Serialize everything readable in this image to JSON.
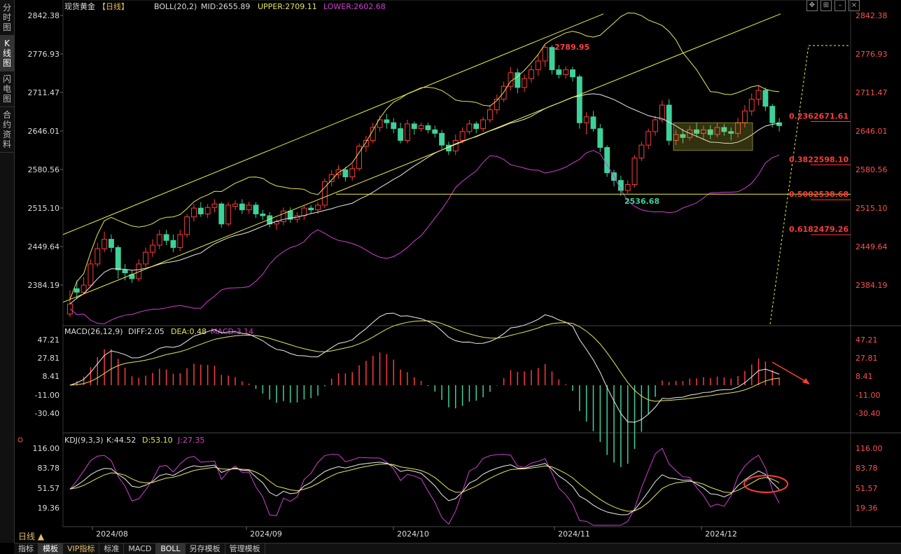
{
  "sidebar": [
    {
      "label": "分\n时\n图",
      "active": false
    },
    {
      "label": "K\n线\n图",
      "active": true
    },
    {
      "label": "闪\n电\n图",
      "active": false
    },
    {
      "label": "合\n约\n资\n料",
      "active": false
    }
  ],
  "header": {
    "title": "现货黄金",
    "period": "【日线】",
    "boll": "BOLL(20,2)",
    "mid": "MID:2655.89",
    "upper": "UPPER:2709.11",
    "lower": "LOWER:2602.68"
  },
  "macd_header": {
    "name": "MACD(26,12,9)",
    "diff": "DIFF:2.05",
    "dea": "DEA:0.48",
    "macd": "MACD:3.14"
  },
  "kdj_header": {
    "name": "KDJ(9,3,3)",
    "k": "K:44.52",
    "d": "D:53.10",
    "j": "J:27.35"
  },
  "price_ticks": [
    "2842.38",
    "2776.93",
    "2711.47",
    "2646.01",
    "2580.56",
    "2515.10",
    "2449.64",
    "2384.19"
  ],
  "macd_ticks": [
    "47.21",
    "27.81",
    "8.41",
    "-11.00",
    "-30.40"
  ],
  "kdj_ticks": [
    "116.00",
    "83.78",
    "51.57",
    "19.36"
  ],
  "date_labels": [
    "2024/08",
    "2024/09",
    "2024/10",
    "2024/11",
    "2024/12"
  ],
  "annotations": {
    "high": "2789.95",
    "low": "2536.68",
    "fib": [
      {
        "label": "0.236",
        "value": "2671.61",
        "price": 2671.61
      },
      {
        "label": "0.382",
        "value": "2598.10",
        "price": 2598.1
      },
      {
        "label": "0.500",
        "value": "2538.68",
        "price": 2538.68
      },
      {
        "label": "0.618",
        "value": "2479.26",
        "price": 2479.26
      }
    ]
  },
  "bottom_tabs": [
    {
      "label": "指标",
      "active": false,
      "vip": false
    },
    {
      "label": "模板",
      "active": true,
      "vip": false
    },
    {
      "label": "VIP指标",
      "active": false,
      "vip": true
    },
    {
      "label": "标准",
      "active": false,
      "vip": false
    },
    {
      "label": "MACD",
      "active": false,
      "vip": false
    },
    {
      "label": "BOLL",
      "active": true,
      "vip": false
    },
    {
      "label": "另存模板",
      "active": false,
      "vip": false
    },
    {
      "label": "管理模板",
      "active": false,
      "vip": false
    }
  ],
  "period_label": "日线 ▲",
  "colors": {
    "up": "#ff3b3b",
    "down": "#3ed19a",
    "boll": "#e6e65a",
    "mid": "#e8e8e8",
    "lower": "#d040d0",
    "trend": "#f0f040"
  },
  "chart_data": {
    "type": "candlestick",
    "title": "现货黄金",
    "ylim": [
      2360,
      2845
    ],
    "daily_ohlc_approx": [
      [
        2335,
        2352,
        2330,
        2375
      ],
      [
        2378,
        2372,
        2360,
        2392
      ],
      [
        2372,
        2384,
        2368,
        2398
      ],
      [
        2384,
        2420,
        2380,
        2428
      ],
      [
        2420,
        2446,
        2415,
        2456
      ],
      [
        2446,
        2462,
        2440,
        2475
      ],
      [
        2462,
        2448,
        2440,
        2470
      ],
      [
        2448,
        2410,
        2395,
        2452
      ],
      [
        2410,
        2405,
        2392,
        2420
      ],
      [
        2402,
        2395,
        2388,
        2410
      ],
      [
        2395,
        2420,
        2390,
        2428
      ],
      [
        2420,
        2440,
        2415,
        2448
      ],
      [
        2440,
        2452,
        2432,
        2462
      ],
      [
        2452,
        2470,
        2445,
        2478
      ],
      [
        2470,
        2460,
        2452,
        2478
      ],
      [
        2460,
        2448,
        2440,
        2470
      ],
      [
        2448,
        2470,
        2442,
        2478
      ],
      [
        2470,
        2500,
        2465,
        2505
      ],
      [
        2500,
        2515,
        2492,
        2522
      ],
      [
        2515,
        2505,
        2500,
        2525
      ],
      [
        2505,
        2516,
        2498,
        2522
      ],
      [
        2516,
        2522,
        2508,
        2530
      ],
      [
        2522,
        2488,
        2482,
        2525
      ],
      [
        2488,
        2520,
        2484,
        2525
      ],
      [
        2518,
        2522,
        2512,
        2528
      ],
      [
        2522,
        2512,
        2505,
        2530
      ],
      [
        2512,
        2520,
        2505,
        2526
      ],
      [
        2520,
        2505,
        2498,
        2525
      ],
      [
        2505,
        2502,
        2495,
        2512
      ],
      [
        2502,
        2488,
        2482,
        2508
      ],
      [
        2488,
        2492,
        2478,
        2496
      ],
      [
        2492,
        2510,
        2486,
        2516
      ],
      [
        2510,
        2496,
        2490,
        2516
      ],
      [
        2496,
        2502,
        2490,
        2508
      ],
      [
        2502,
        2515,
        2495,
        2520
      ],
      [
        2515,
        2512,
        2505,
        2520
      ],
      [
        2512,
        2520,
        2505,
        2525
      ],
      [
        2520,
        2560,
        2515,
        2565
      ],
      [
        2560,
        2572,
        2552,
        2580
      ],
      [
        2572,
        2580,
        2565,
        2588
      ],
      [
        2580,
        2568,
        2560,
        2585
      ],
      [
        2568,
        2582,
        2562,
        2590
      ],
      [
        2582,
        2620,
        2578,
        2625
      ],
      [
        2620,
        2630,
        2610,
        2638
      ],
      [
        2630,
        2652,
        2625,
        2660
      ],
      [
        2652,
        2665,
        2645,
        2672
      ],
      [
        2665,
        2660,
        2650,
        2675
      ],
      [
        2660,
        2650,
        2642,
        2668
      ],
      [
        2650,
        2630,
        2625,
        2660
      ],
      [
        2630,
        2658,
        2625,
        2665
      ],
      [
        2658,
        2650,
        2640,
        2662
      ],
      [
        2650,
        2655,
        2645,
        2660
      ],
      [
        2655,
        2648,
        2642,
        2660
      ],
      [
        2648,
        2642,
        2635,
        2655
      ],
      [
        2642,
        2622,
        2615,
        2648
      ],
      [
        2622,
        2612,
        2605,
        2628
      ],
      [
        2612,
        2630,
        2605,
        2640
      ],
      [
        2630,
        2645,
        2625,
        2652
      ],
      [
        2645,
        2658,
        2640,
        2665
      ],
      [
        2658,
        2650,
        2642,
        2662
      ],
      [
        2650,
        2665,
        2645,
        2670
      ],
      [
        2665,
        2682,
        2660,
        2690
      ],
      [
        2682,
        2700,
        2675,
        2708
      ],
      [
        2700,
        2722,
        2695,
        2730
      ],
      [
        2722,
        2745,
        2715,
        2755
      ],
      [
        2745,
        2720,
        2710,
        2752
      ],
      [
        2720,
        2735,
        2712,
        2742
      ],
      [
        2735,
        2750,
        2728,
        2758
      ],
      [
        2750,
        2765,
        2740,
        2775
      ],
      [
        2765,
        2788,
        2755,
        2792
      ],
      [
        2788,
        2750,
        2742,
        2792
      ],
      [
        2750,
        2742,
        2735,
        2758
      ],
      [
        2742,
        2750,
        2735,
        2756
      ],
      [
        2750,
        2738,
        2730,
        2755
      ],
      [
        2738,
        2660,
        2650,
        2742
      ],
      [
        2660,
        2670,
        2640,
        2678
      ],
      [
        2670,
        2650,
        2645,
        2680
      ],
      [
        2650,
        2618,
        2610,
        2658
      ],
      [
        2618,
        2575,
        2568,
        2622
      ],
      [
        2575,
        2562,
        2552,
        2580
      ],
      [
        2562,
        2545,
        2536,
        2570
      ],
      [
        2545,
        2555,
        2540,
        2562
      ],
      [
        2555,
        2600,
        2550,
        2605
      ],
      [
        2600,
        2622,
        2595,
        2628
      ],
      [
        2622,
        2645,
        2615,
        2650
      ],
      [
        2645,
        2665,
        2638,
        2672
      ],
      [
        2665,
        2690,
        2660,
        2698
      ],
      [
        2690,
        2630,
        2622,
        2700
      ],
      [
        2630,
        2640,
        2622,
        2648
      ],
      [
        2640,
        2635,
        2625,
        2650
      ],
      [
        2635,
        2648,
        2630,
        2655
      ],
      [
        2648,
        2642,
        2635,
        2660
      ],
      [
        2642,
        2648,
        2632,
        2655
      ],
      [
        2648,
        2640,
        2632,
        2656
      ],
      [
        2640,
        2652,
        2635,
        2660
      ],
      [
        2652,
        2645,
        2638,
        2658
      ],
      [
        2645,
        2642,
        2630,
        2652
      ],
      [
        2642,
        2660,
        2635,
        2668
      ],
      [
        2660,
        2680,
        2652,
        2690
      ],
      [
        2680,
        2700,
        2672,
        2710
      ],
      [
        2700,
        2715,
        2690,
        2722
      ],
      [
        2715,
        2688,
        2680,
        2720
      ],
      [
        2688,
        2660,
        2652,
        2692
      ],
      [
        2660,
        2655,
        2645,
        2668
      ]
    ],
    "boll_last": {
      "mid": 2655.89,
      "upper": 2709.11,
      "lower": 2602.68
    }
  }
}
